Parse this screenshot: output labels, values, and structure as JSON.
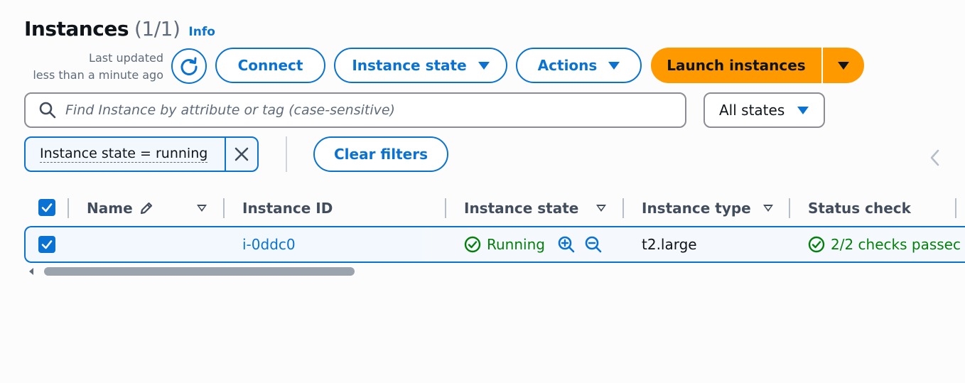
{
  "header": {
    "title": "Instances",
    "count": "(1/1)",
    "info_label": "Info",
    "last_updated_line1": "Last updated",
    "last_updated_line2": "less than a minute ago"
  },
  "toolbar": {
    "connect_label": "Connect",
    "instance_state_label": "Instance state",
    "actions_label": "Actions",
    "launch_label": "Launch instances"
  },
  "search": {
    "placeholder": "Find Instance by attribute or tag (case-sensitive)",
    "value": ""
  },
  "state_filter": {
    "selected": "All states"
  },
  "filter_token": {
    "label": "Instance state = running"
  },
  "clear_filters_label": "Clear filters",
  "table": {
    "columns": [
      "Name",
      "Instance ID",
      "Instance state",
      "Instance type",
      "Status check"
    ],
    "rows": [
      {
        "name": "",
        "instance_id": "i-0ddc0",
        "instance_state": "Running",
        "instance_type": "t2.large",
        "status_check": "2/2 checks passec"
      }
    ]
  },
  "colors": {
    "accent": "#0972d3",
    "primary_button": "#ff9900",
    "success": "#037f0c"
  },
  "icons": [
    "refresh-icon",
    "caret-down-icon",
    "search-icon",
    "close-icon",
    "chevron-left-icon",
    "pencil-icon",
    "sort-icon",
    "checkmark-icon",
    "check-circle-icon",
    "zoom-in-icon",
    "zoom-out-icon"
  ]
}
